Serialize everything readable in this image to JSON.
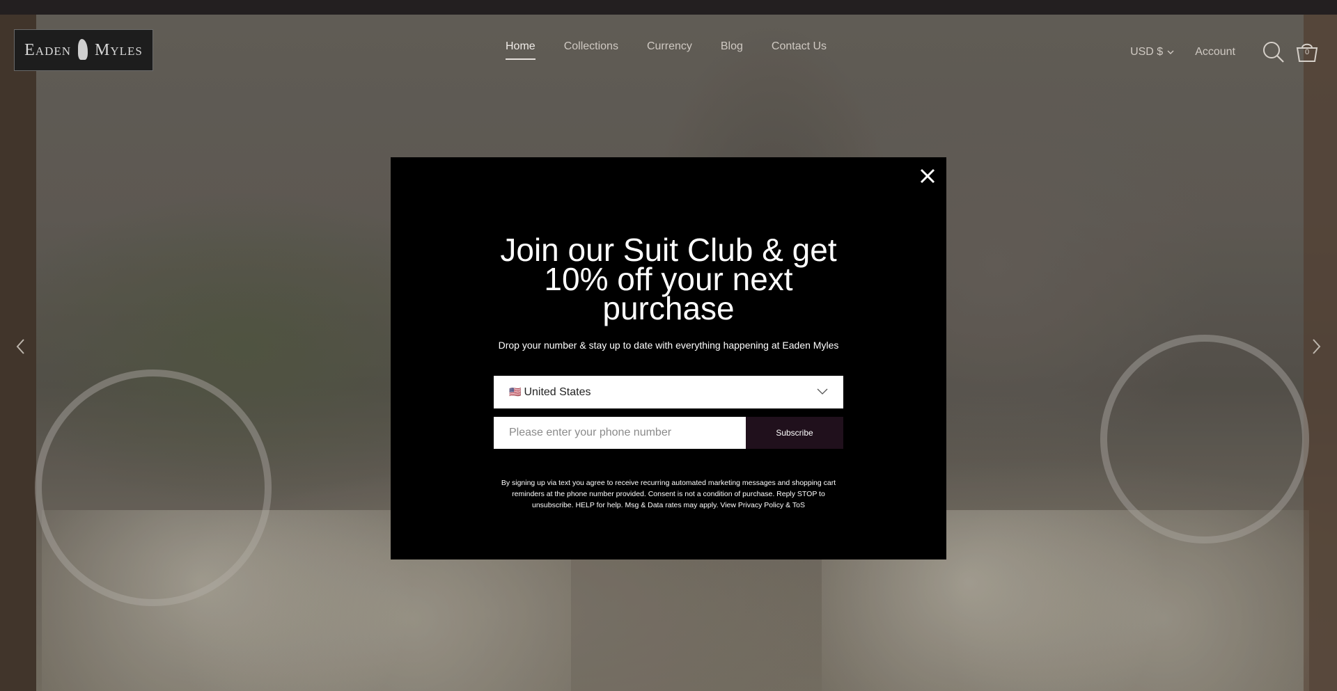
{
  "brand": {
    "logo_left": "Eaden",
    "logo_right": "Myles"
  },
  "nav": {
    "items": [
      {
        "label": "Home",
        "active": true
      },
      {
        "label": "Collections",
        "active": false
      },
      {
        "label": "Currency",
        "active": false
      },
      {
        "label": "Blog",
        "active": false
      },
      {
        "label": "Contact Us",
        "active": false
      }
    ]
  },
  "header": {
    "currency_label": "USD $",
    "account_label": "Account",
    "cart_count": "0",
    "icons": [
      "search-icon",
      "cart-icon",
      "chevron-down-icon"
    ]
  },
  "hero": {
    "icons": [
      "chevron-left-icon",
      "chevron-right-icon"
    ]
  },
  "modal": {
    "title": "Join our Suit Club & get 10% off your next purchase",
    "subtitle": "Drop your number & stay up to date with everything happening at Eaden Myles",
    "country": {
      "flag": "🇺🇸",
      "value": "United States"
    },
    "phone_placeholder": "Please enter your phone number",
    "subscribe_label": "Subscribe",
    "legal": "By signing up via text you agree to receive recurring automated marketing messages and shopping cart reminders at the phone number provided. Consent is not a condition of purchase. Reply STOP to unsubscribe. HELP for help. Msg & Data rates may apply. View Privacy Policy & ToS",
    "icons": [
      "close-icon"
    ]
  },
  "colors": {
    "topbar": "#231f20",
    "modal_bg": "#000000",
    "subscribe_bg": "#20101c",
    "nav_text": "#cfc9c2"
  }
}
